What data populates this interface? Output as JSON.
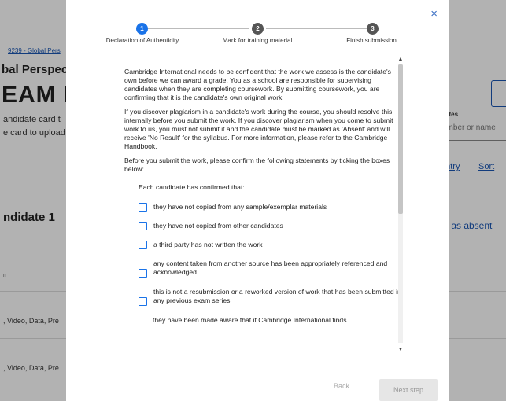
{
  "background": {
    "breadcrumb": "9239 - Global Pers",
    "course_title": "bal Perspect",
    "exam_title": "EAM PI",
    "line1": "andidate card t",
    "line2": "e card to upload",
    "candidate_heading": "ndidate 1",
    "column_label": "n",
    "row1": ", Video, Data, Pre",
    "row2": ", Video, Data, Pre",
    "dates_label": "ates",
    "search_placeholder": "umber or name",
    "link_entry": "entry",
    "link_sort": "Sort",
    "link_absent": "rk as absent"
  },
  "modal": {
    "close_glyph": "×",
    "steps": [
      {
        "number": "1",
        "label": "Declaration of Authenticity",
        "state": "active"
      },
      {
        "number": "2",
        "label": "Mark for training material",
        "state": "inactive"
      },
      {
        "number": "3",
        "label": "Finish submission",
        "state": "inactive"
      }
    ],
    "paragraphs": [
      "Cambridge International needs to be confident that the work we assess is the candidate's own before we can award a grade. You as a school are responsible for supervising candidates when they are completing coursework. By submitting coursework, you are confirming that it is the candidate's own original work.",
      "If you discover plagiarism in a candidate's work during the course, you should resolve this internally before you submit the work. If you discover plagiarism when you come to submit work to us, you must not submit it and the candidate must be marked as 'Absent' and will receive 'No Result' for the syllabus. For more information, please refer to the Cambridge Handbook.",
      "Before you submit the work, please confirm the following statements by ticking the boxes below:"
    ],
    "confirm_heading": "Each candidate has confirmed that:",
    "checkboxes": [
      "they have not copied from any sample/exemplar materials",
      "they have not copied from other candidates",
      "a third party has not written the work",
      "any content taken from another source has been appropriately referenced and acknowledged",
      "this is not a resubmission or a reworked version of work that has been submitted in any previous exam series"
    ],
    "trailing_text": "they have been made aware that if Cambridge International finds",
    "back_label": "Back",
    "next_label": "Next step"
  },
  "colors": {
    "accent": "#1a73e8",
    "inactive_step": "#555555",
    "link": "#1a56b3"
  }
}
